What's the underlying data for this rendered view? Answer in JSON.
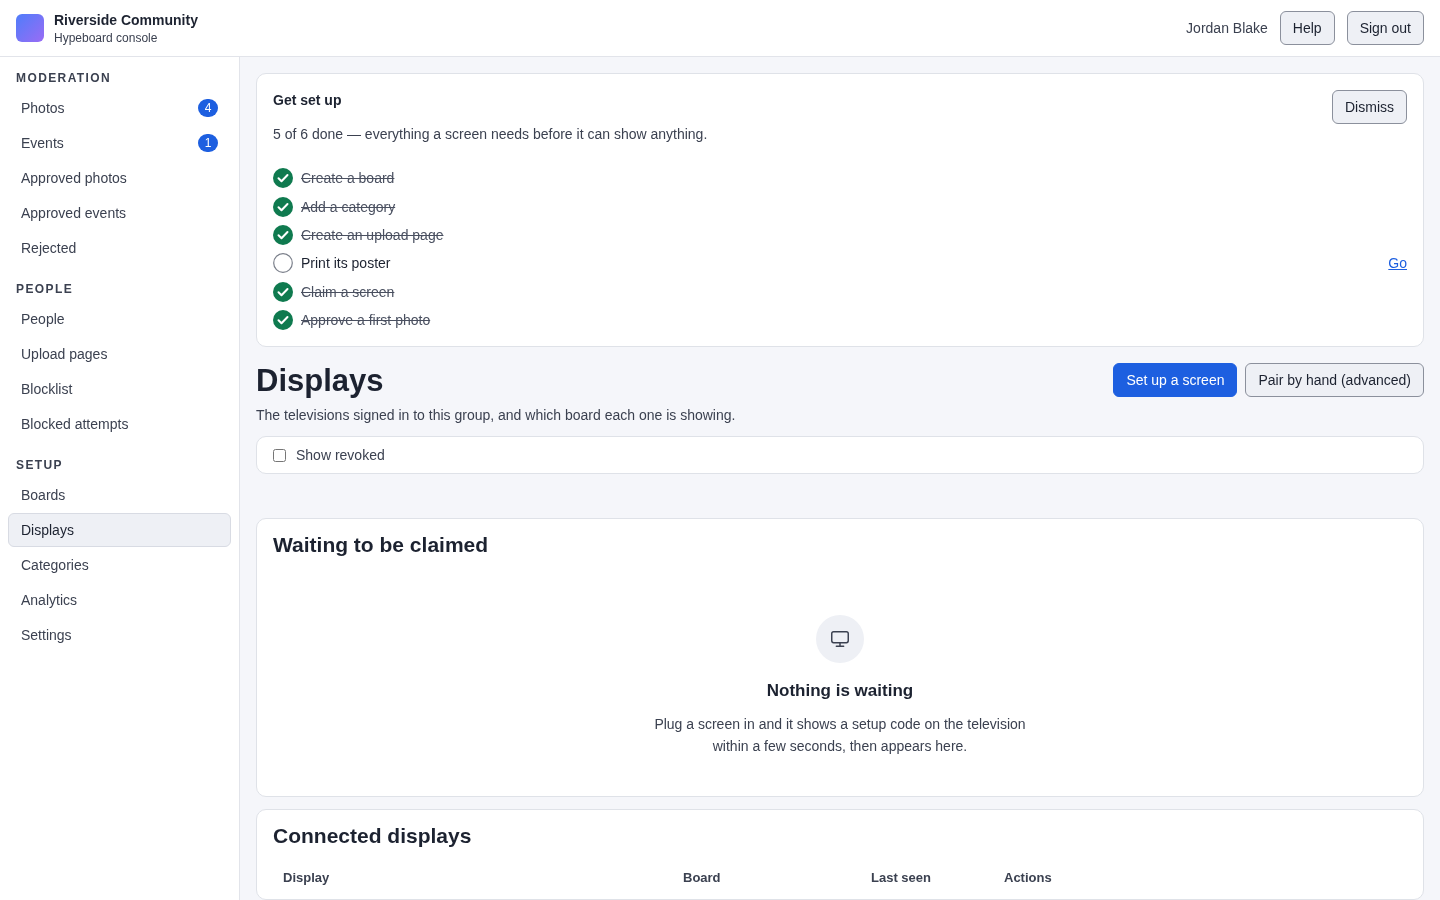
{
  "header": {
    "org": "Riverside Community",
    "subtitle": "Hypeboard console",
    "user": "Jordan Blake",
    "buttons": [
      "Help",
      "Sign out"
    ]
  },
  "sidebar": {
    "sections": [
      {
        "title": "MODERATION",
        "items": [
          {
            "label": "Photos",
            "badge": "4",
            "selected": false
          },
          {
            "label": "Events",
            "badge": "1",
            "selected": false
          },
          {
            "label": "Approved photos",
            "selected": false
          },
          {
            "label": "Approved events",
            "selected": false
          },
          {
            "label": "Rejected",
            "selected": false
          }
        ]
      },
      {
        "title": "PEOPLE",
        "items": [
          {
            "label": "People",
            "selected": false
          },
          {
            "label": "Upload pages",
            "selected": false
          },
          {
            "label": "Blocklist",
            "selected": false
          },
          {
            "label": "Blocked attempts",
            "selected": false
          }
        ]
      },
      {
        "title": "SETUP",
        "items": [
          {
            "label": "Boards",
            "selected": false
          },
          {
            "label": "Displays",
            "selected": true
          },
          {
            "label": "Categories",
            "selected": false
          },
          {
            "label": "Analytics",
            "selected": false
          },
          {
            "label": "Settings",
            "selected": false
          }
        ]
      }
    ]
  },
  "setup": {
    "title": "Get set up",
    "summary": "5 of 6 done — everything a screen needs before it can show anything.",
    "dismiss": "Dismiss",
    "steps": [
      {
        "label": "Create a board",
        "checked": true
      },
      {
        "label": "Add a category",
        "checked": true
      },
      {
        "label": "Create an upload page",
        "checked": true
      },
      {
        "label": "Print its poster",
        "checked": false,
        "link": "Go"
      },
      {
        "label": "Claim a screen",
        "checked": true
      },
      {
        "label": "Approve a first photo",
        "checked": true
      }
    ]
  },
  "page": {
    "title": "Displays",
    "description": "The televisions signed in to this group, and which board each one is showing.",
    "primary": "Set up a screen",
    "secondary": "Pair by hand (advanced)"
  },
  "filter": {
    "label": "Show revoked",
    "checked": false
  },
  "waiting": {
    "title": "Waiting to be claimed",
    "empty_title": "Nothing is waiting",
    "empty_text": "Plug a screen in and it shows a setup code on the television within a few seconds, then appears here."
  },
  "connected": {
    "title": "Connected displays",
    "columns": [
      "Display",
      "Board",
      "Last seen",
      "Actions"
    ]
  }
}
